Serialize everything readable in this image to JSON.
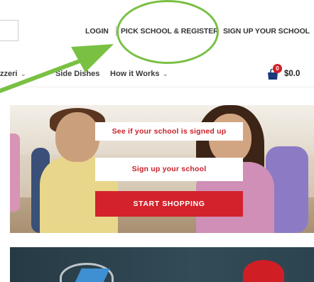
{
  "header": {
    "links": {
      "login": "LOGIN",
      "pick_school": "PICK SCHOOL & REGISTER",
      "sign_up": "SIGN UP YOUR SCHOOL"
    }
  },
  "nav": {
    "items": [
      {
        "label": "zzeri",
        "has_dropdown": true
      },
      {
        "label": "Side Dishes",
        "has_dropdown": false
      },
      {
        "label": "How it Works",
        "has_dropdown": true
      }
    ],
    "chevron": "⌄"
  },
  "cart": {
    "count": "0",
    "total": "$0.0",
    "icon": "shopping-bag-icon"
  },
  "hero": {
    "buttons": {
      "check_school": "See if your school is signed up",
      "sign_up_school": "Sign up your school",
      "start_shopping": "START SHOPPING"
    }
  },
  "colors": {
    "brand_red": "#d3222b",
    "highlight_green": "#79c043",
    "cart_navy": "#1a3a7a"
  }
}
